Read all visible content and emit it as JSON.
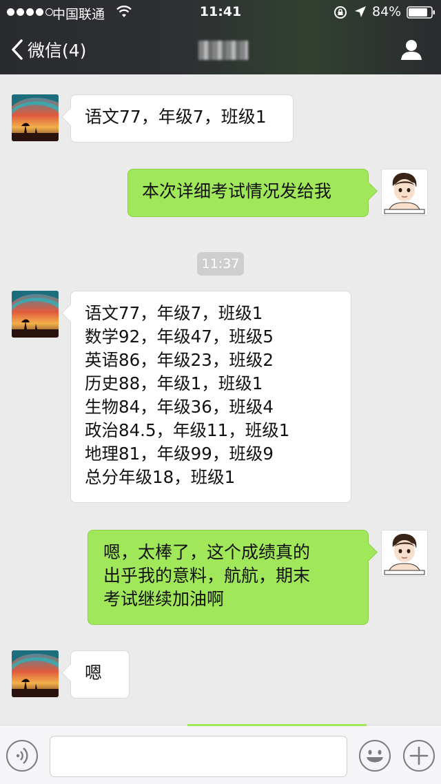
{
  "status_bar": {
    "carrier": "中国联通",
    "time": "11:41",
    "battery": "84%",
    "battery_level": 0.84
  },
  "nav": {
    "back_label": "微信(4)"
  },
  "messages": [
    {
      "side": "left",
      "text": "语文77，年级7，班级1"
    },
    {
      "side": "right",
      "text": "本次详细考试情况发给我"
    },
    {
      "side": "left",
      "text": "语文77，年级7，班级1\n数学92，年级47，班级5\n英语86，年级23，班级2\n历史88，年级1，班级1\n生物84，年级36，班级4\n政治84.5，年级11，班级1\n地理81，年级99，班级9\n总分年级18，班级1"
    },
    {
      "side": "right",
      "text": "嗯，太棒了，这个成绩真的\n出乎我的意料，航航，期末\n考试继续加油啊"
    },
    {
      "side": "left",
      "text": "嗯"
    }
  ],
  "timestamp": "11:37",
  "colors": {
    "sent_bubble": "#a0e75a",
    "received_bubble": "#ffffff",
    "background": "#ebebeb"
  }
}
